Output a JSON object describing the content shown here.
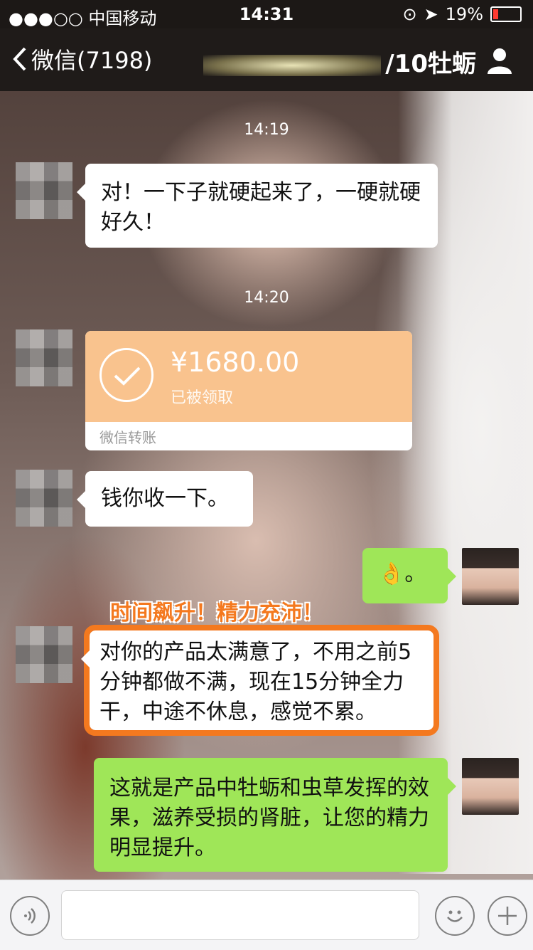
{
  "status_bar": {
    "carrier": "●●●○○ 中国移动",
    "time": "14:31",
    "battery": "19%",
    "battery_level": 0.19
  },
  "nav": {
    "back_label": "微信(7198)",
    "title_suffix": "/10牡蛎"
  },
  "messages": {
    "ts1": "14:19",
    "msg1": "对！一下子就硬起来了，一硬就硬好久！",
    "ts2": "14:20",
    "transfer": {
      "amount": "¥1680.00",
      "status": "已被领取",
      "footer": "微信转账"
    },
    "msg2": "钱你收一下。",
    "msg3": "👌。",
    "caption": "时间飙升！精力充沛！",
    "msg4": "对你的产品太满意了，不用之前5分钟都做不满，现在15分钟全力干，中途不休息，感觉不累。",
    "msg5": "这就是产品中牡蛎和虫草发挥的效果，滋养受损的肾脏，让您的精力明显提升。"
  },
  "input_bar": {
    "voice_icon": "voice-icon",
    "emoji_icon": "emoji-icon",
    "plus_icon": "plus-icon"
  },
  "colors": {
    "accent_green": "#9fe658",
    "highlight_orange": "#f4791f",
    "transfer_orange": "#f9c38e"
  }
}
